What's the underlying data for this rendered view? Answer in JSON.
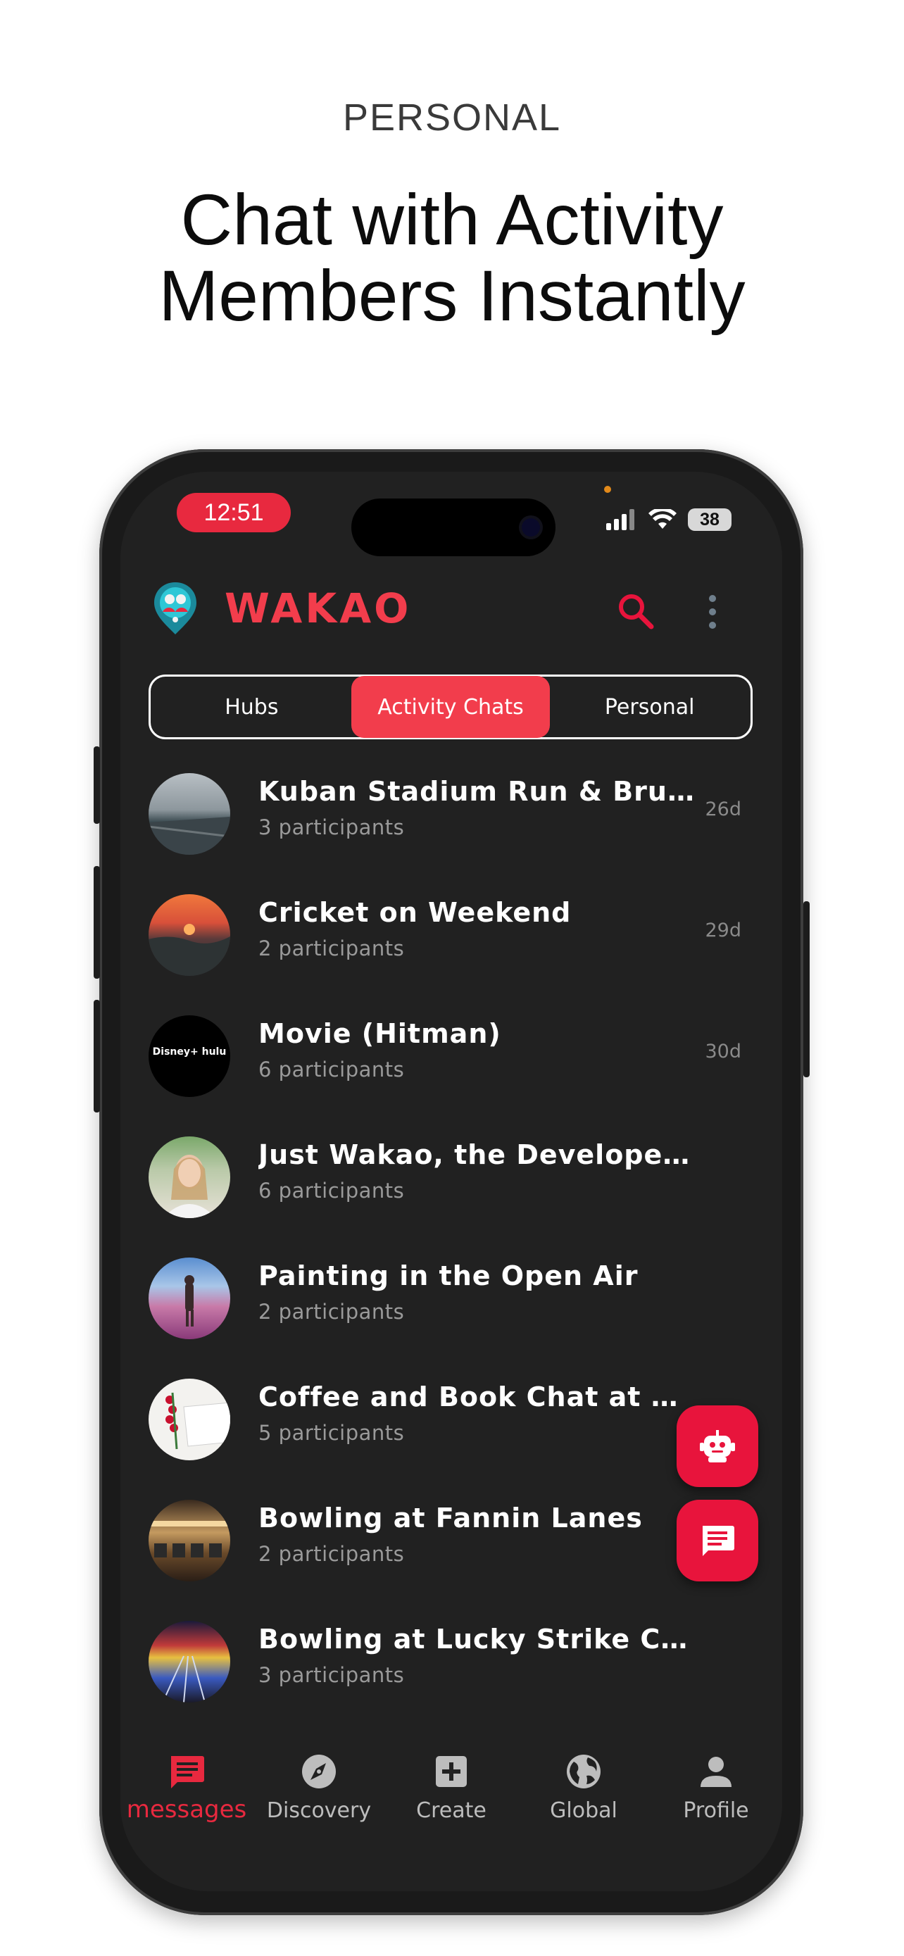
{
  "promo": {
    "label": "PERSONAL",
    "title_line1": "Chat with Activity",
    "title_line2": "Members Instantly"
  },
  "status_bar": {
    "time": "12:51",
    "battery": "38"
  },
  "header": {
    "app_name": "WAKAO"
  },
  "tabs": [
    {
      "label": "Hubs",
      "active": false
    },
    {
      "label": "Activity Chats",
      "active": true
    },
    {
      "label": "Personal",
      "active": false
    }
  ],
  "chats": [
    {
      "title": "Kuban Stadium Run & Brunch",
      "participants": "3 participants",
      "time": "26d"
    },
    {
      "title": "Cricket on Weekend",
      "participants": "2 participants",
      "time": "29d"
    },
    {
      "title": "Movie (Hitman)",
      "participants": "6 participants",
      "time": "30d",
      "avatar_text": "Disney+ hulu"
    },
    {
      "title": "Just Wakao, the Developer F...",
      "participants": "6 participants",
      "time": ""
    },
    {
      "title": "Painting in the Open Air",
      "participants": "2 participants",
      "time": ""
    },
    {
      "title": "Coffee and Book Chat at Bar...",
      "participants": "5 participants",
      "time": ""
    },
    {
      "title": "Bowling at Fannin Lanes",
      "participants": "2 participants",
      "time": ""
    },
    {
      "title": "Bowling at Lucky Strike Cen...",
      "participants": "3 participants",
      "time": ""
    }
  ],
  "fabs": {
    "bot_icon": "robot-icon",
    "chat_icon": "message-icon"
  },
  "bottom_nav": [
    {
      "label": "messages",
      "icon": "message-icon",
      "active": true
    },
    {
      "label": "Discovery",
      "icon": "compass-icon",
      "active": false
    },
    {
      "label": "Create",
      "icon": "plus-box-icon",
      "active": false
    },
    {
      "label": "Global",
      "icon": "globe-icon",
      "active": false
    },
    {
      "label": "Profile",
      "icon": "person-icon",
      "active": false
    }
  ],
  "colors": {
    "accent": "#f23d4c",
    "fab": "#e8143c",
    "screen_bg": "#212121"
  }
}
